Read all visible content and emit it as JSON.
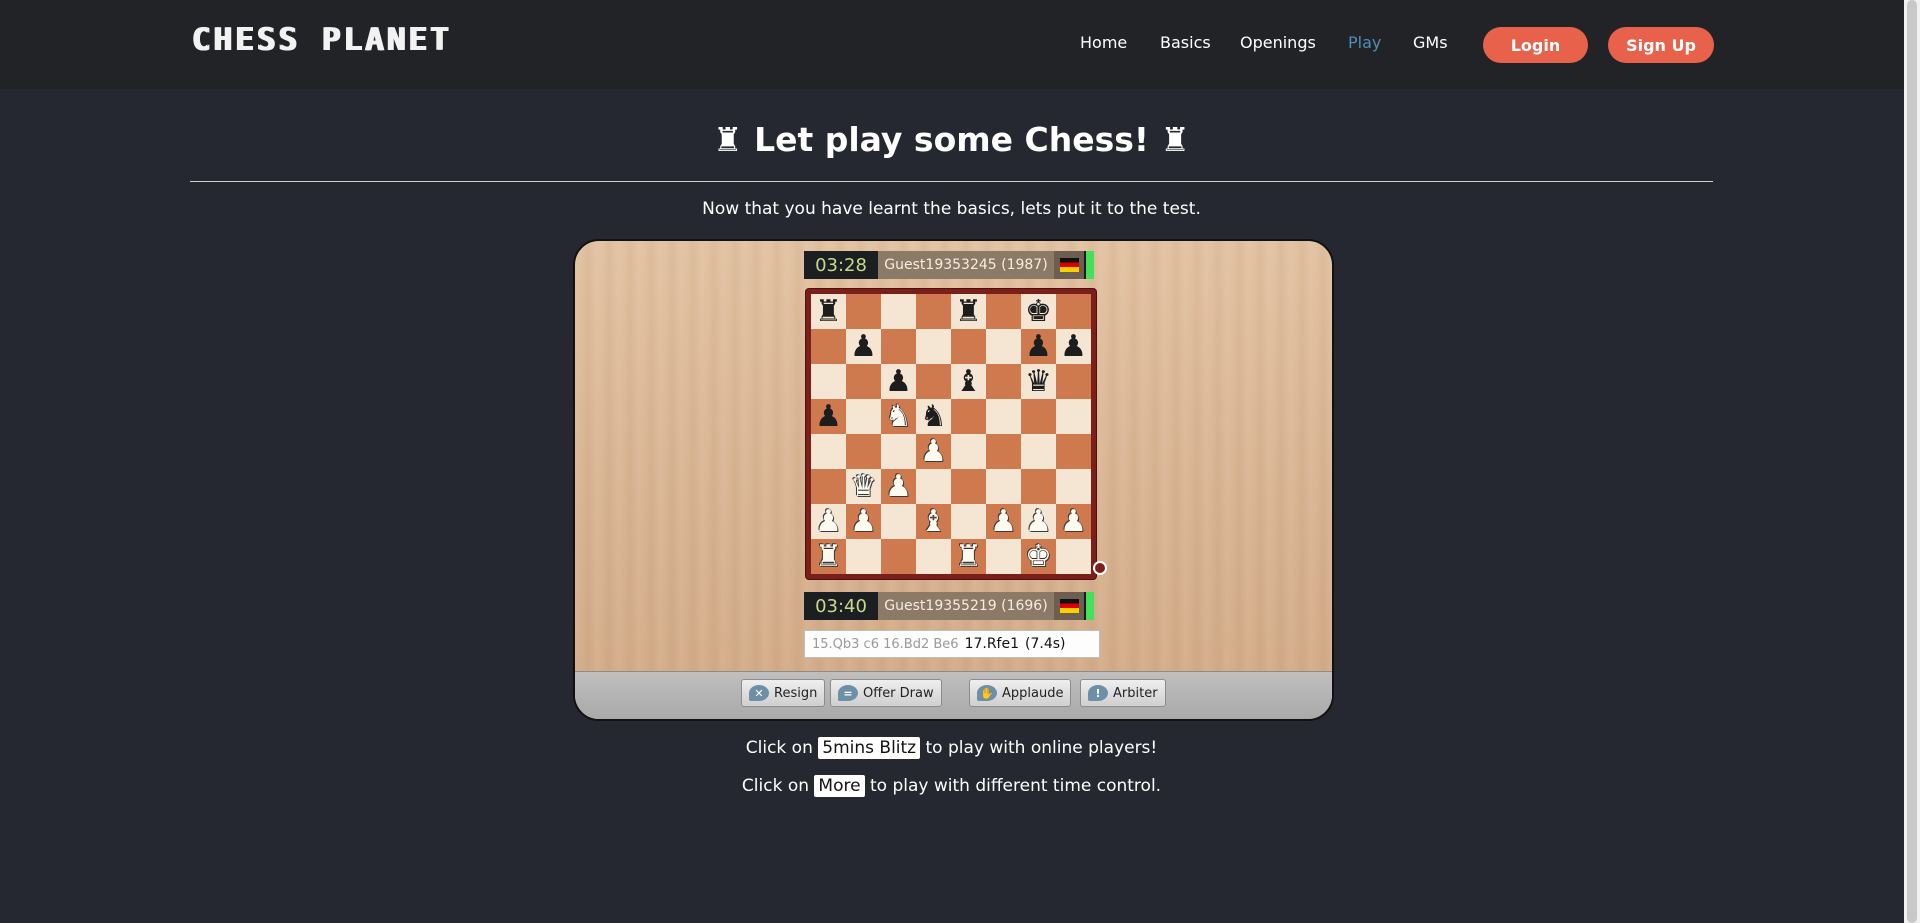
{
  "header": {
    "logo": "CHESS PLANET",
    "nav": [
      {
        "label": "Home"
      },
      {
        "label": "Basics"
      },
      {
        "label": "Openings"
      },
      {
        "label": "Play",
        "active": true
      },
      {
        "label": "GMs"
      }
    ],
    "login_label": "Login",
    "signup_label": "Sign Up"
  },
  "main": {
    "title_icon": "♜",
    "title": "Let play some Chess!",
    "subtitle": "Now that you have learnt the basics, lets put it to the test."
  },
  "game": {
    "top_player": {
      "clock": "03:28",
      "name": "Guest19353245 (1987)",
      "flag": "germany-flag-icon"
    },
    "bottom_player": {
      "clock": "03:40",
      "name": "Guest19355219 (1696)",
      "flag": "germany-flag-icon"
    },
    "board": [
      [
        "r",
        "",
        "",
        "",
        "r",
        "",
        "k",
        ""
      ],
      [
        "",
        "p",
        "",
        "",
        "",
        "",
        "p",
        "p"
      ],
      [
        "",
        "",
        "p",
        "",
        "b",
        "",
        "q",
        ""
      ],
      [
        "p",
        "",
        "N",
        "n",
        "",
        "",
        "",
        ""
      ],
      [
        "",
        "",
        "",
        "P",
        "",
        "",
        "",
        ""
      ],
      [
        "",
        "Q",
        "P",
        "",
        "",
        "",
        "",
        ""
      ],
      [
        "P",
        "P",
        "",
        "B",
        "",
        "P",
        "P",
        "P"
      ],
      [
        "R",
        "",
        "",
        "",
        "R",
        "",
        "K",
        ""
      ]
    ],
    "moves_prev": "15.Qb3 c6 16.Bd2 Be6",
    "move_current": "17.Rfe1",
    "move_time": "(7.4s)",
    "actions": [
      {
        "label": "Resign",
        "icon": "resign-icon"
      },
      {
        "label": "Offer Draw",
        "icon": "offer-draw-icon"
      },
      {
        "label": "Applaude",
        "icon": "applause-icon"
      },
      {
        "label": "Arbiter",
        "icon": "arbiter-icon"
      }
    ]
  },
  "hints": {
    "line1_before": "Click on",
    "line1_chip": "5mins Blitz",
    "line1_after": "to play with online players!",
    "line2_before": "Click on",
    "line2_chip": "More",
    "line2_after": "to play with different time control."
  },
  "colors": {
    "background": "#252830",
    "header": "#222327",
    "accent": "#e8624b",
    "active_nav": "#4d8fb5"
  }
}
